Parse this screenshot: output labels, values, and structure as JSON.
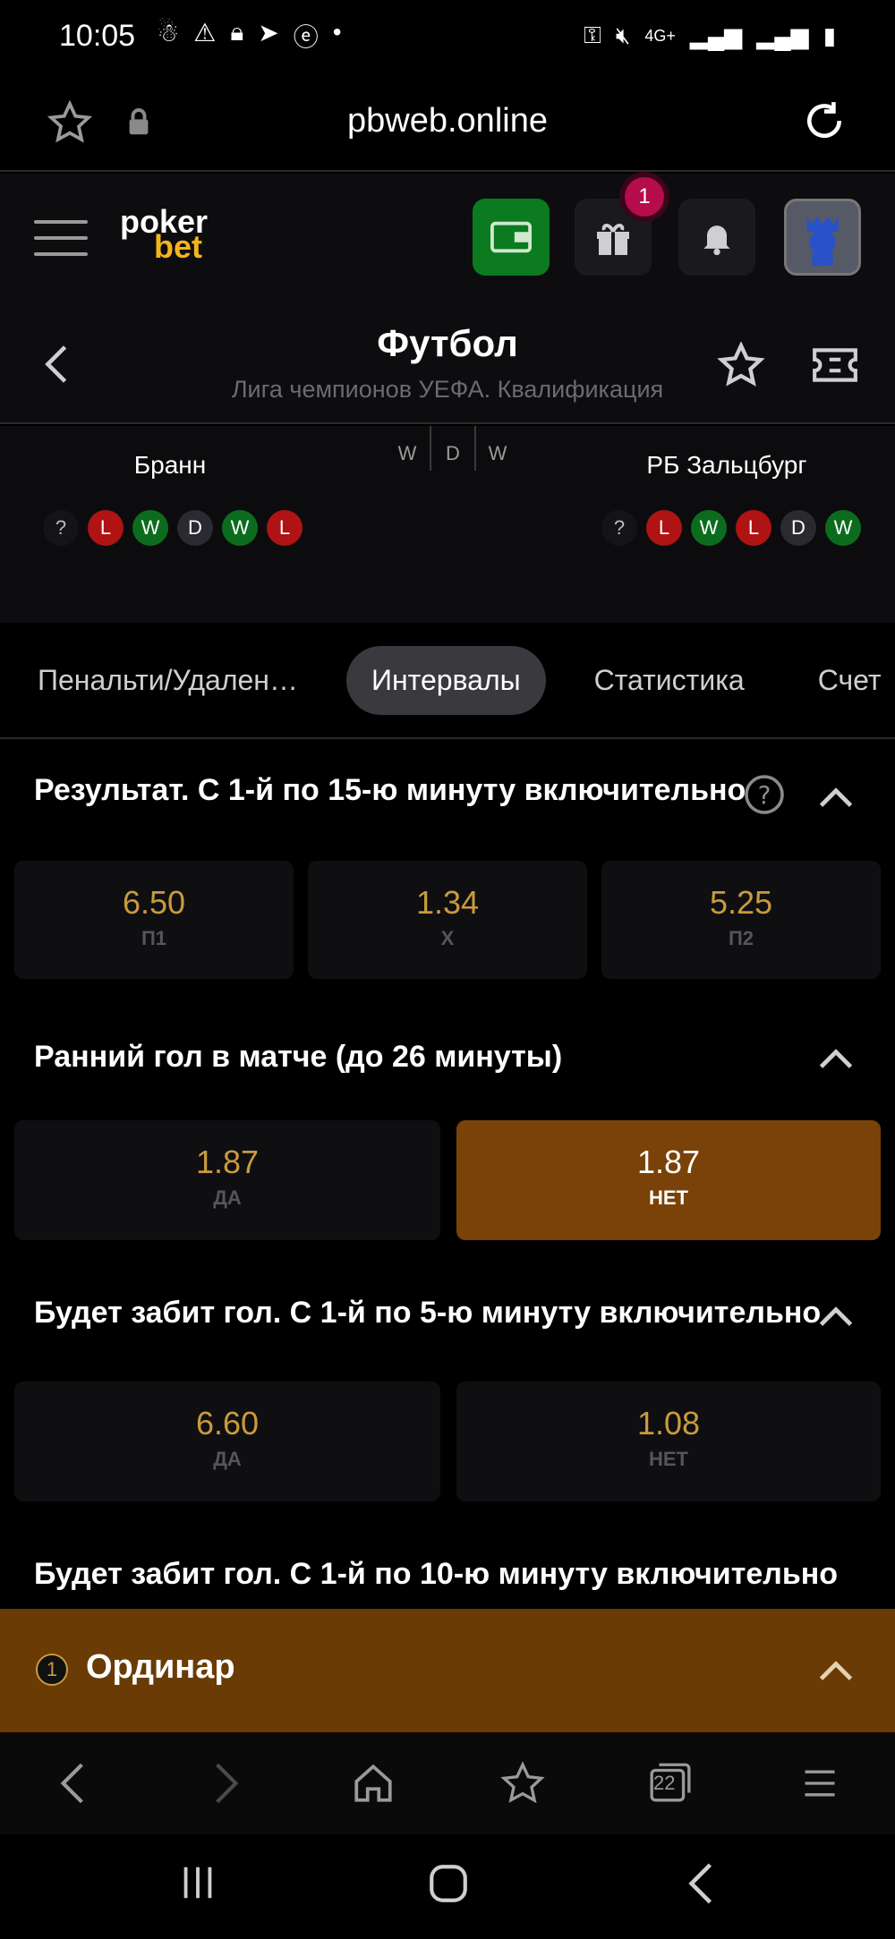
{
  "status_bar": {
    "time": "10:05",
    "network": "4G+"
  },
  "browser": {
    "url": "pbweb.online",
    "tab_count": "22"
  },
  "header": {
    "logo_top": "poker",
    "logo_bottom": "bet",
    "gift_badge": "1"
  },
  "page": {
    "title": "Футбол",
    "subtitle": "Лига чемпионов УЕФА. Квалификация"
  },
  "match": {
    "team1": "Бранн",
    "team2": "РБ Зальцбург",
    "h2h": [
      "W",
      "D",
      "W"
    ],
    "team1_form": [
      "?",
      "L",
      "W",
      "D",
      "W",
      "L"
    ],
    "team2_form": [
      "?",
      "L",
      "W",
      "L",
      "D",
      "W"
    ]
  },
  "tabs": [
    {
      "label": "Пенальти/Удален…",
      "active": false
    },
    {
      "label": "Интервалы",
      "active": true
    },
    {
      "label": "Статистика",
      "active": false
    },
    {
      "label": "Счет",
      "active": false
    }
  ],
  "markets": [
    {
      "title": "Результат. С 1-й по 15-ю минуту включительно",
      "odds": [
        {
          "value": "6.50",
          "label": "П1"
        },
        {
          "value": "1.34",
          "label": "Х"
        },
        {
          "value": "5.25",
          "label": "П2"
        }
      ]
    },
    {
      "title": "Ранний гол в матче (до 26 минуты)",
      "odds": [
        {
          "value": "1.87",
          "label": "ДА",
          "selected": false
        },
        {
          "value": "1.87",
          "label": "НЕТ",
          "selected": true
        }
      ]
    },
    {
      "title": "Будет забит гол. С 1-й по 5-ю минуту включительно",
      "odds": [
        {
          "value": "6.60",
          "label": "ДА"
        },
        {
          "value": "1.08",
          "label": "НЕТ"
        }
      ]
    },
    {
      "title": "Будет забит гол. С 1-й по 10-ю минуту включительно"
    }
  ],
  "betslip": {
    "count": "1",
    "label": "Ординар"
  },
  "colors": {
    "odds": "#c99b3c",
    "selected": "#7a4208",
    "betslip": "#6a3b04",
    "wallet": "#0c7a1e"
  }
}
